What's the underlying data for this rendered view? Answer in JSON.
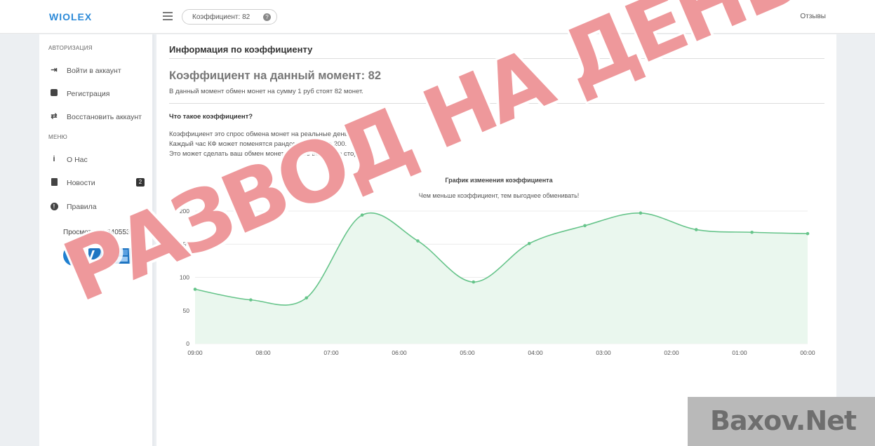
{
  "topbar": {
    "logo": "WIOLEX",
    "coef_pill": "Коэффициент: 82",
    "help_icon": "?",
    "reviews_link": "Отзывы"
  },
  "sidebar": {
    "auth_heading": "АВТОРИЗАЦИЯ",
    "auth_items": [
      {
        "label": "Войти в аккаунт",
        "icon": "sign-in-icon"
      },
      {
        "label": "Регистрация",
        "icon": "plus-square-icon"
      },
      {
        "label": "Восстановить аккаунт",
        "icon": "exchange-icon"
      }
    ],
    "menu_heading": "МЕНЮ",
    "menu_items": [
      {
        "label": "О Нас",
        "icon": "info-icon"
      },
      {
        "label": "Новости",
        "icon": "file-icon",
        "badge": "2"
      },
      {
        "label": "Правила",
        "icon": "exclamation-circle-icon"
      }
    ],
    "views": "Просмотров: 340553",
    "payeer_logo": "P"
  },
  "main": {
    "title": "Информация по коэффициенту",
    "coef_title": "Коэффициент на данный момент: 82",
    "coef_desc": "В данный момент обмен монет на сумму 1 руб стоят 82 монет.",
    "question_title": "Что такое коэффициент?",
    "question_lines": [
      "Коэффициент это спрос обмена монет на реальные деньги.",
      "Каждый час КФ может поменятся рандомно от 50 до 200.",
      "Это может сделать ваш обмен монет в более выгодную сторону."
    ]
  },
  "chart_data": {
    "type": "area",
    "title": "График изменения коэффициента",
    "subtitle": "Чем меньше коэффициент, тем выгоднее обменивать!",
    "categories": [
      "09:00",
      "08:00",
      "07:00",
      "06:00",
      "05:00",
      "04:00",
      "03:00",
      "02:00",
      "01:00",
      "00:00"
    ],
    "series": [
      {
        "values": [
          82,
          66,
          69,
          194,
          155,
          93,
          151,
          178,
          197,
          172,
          168,
          166
        ]
      }
    ],
    "x_positions_note": "",
    "yticks": [
      0,
      50,
      100,
      150,
      200
    ],
    "ylim": [
      0,
      200
    ],
    "grid": true,
    "line_color": "#66c48a",
    "fill_color": "#eaf7ee"
  },
  "watermarks": {
    "stamp": "РАЗВОД НА ДЕНЬГИ",
    "site": "Baxov.Net"
  }
}
